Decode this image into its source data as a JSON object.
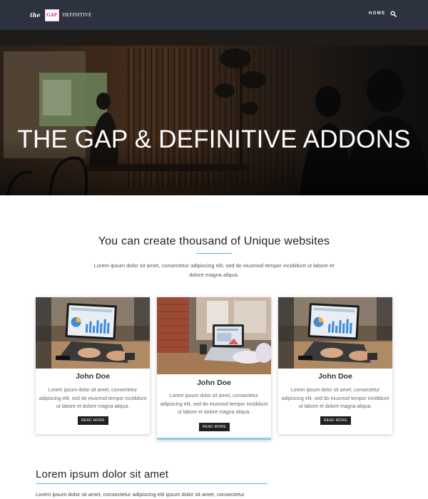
{
  "header": {
    "logo": {
      "the": "the",
      "gap": "GAP",
      "definitive": "DEFINITIVE"
    },
    "nav": {
      "home_label": "HOME"
    },
    "search_icon": "search-icon"
  },
  "hero": {
    "title": "THE GAP & DEFINITIVE ADDONS",
    "image": "cafe-interior-photo"
  },
  "intro": {
    "title": "You can create thousand of Unique websites",
    "text": "Lorem ipsum dolor sit amet, consectetur adipiscing elit, sed do eiusmod tempor incididunt ut labore et dolore magna aliqua."
  },
  "cards": [
    {
      "image": "laptop-charts-photo",
      "name": "John Doe",
      "text": "Lorem ipsum dolor sit amet, consectetur adipiscing elit, sed do eiusmod tempor incididunt ut labore et dolore magna aliqua.",
      "button": "READ MORE"
    },
    {
      "image": "laptop-office-photo",
      "name": "John Doe",
      "text": "Lorem ipsum dolor sit amet, consectetur adipiscing elit, sed do eiusmod tempor incididunt ut labore et dolore magna aliqua.",
      "button": "READ MORE"
    },
    {
      "image": "laptop-charts-photo",
      "name": "John Doe",
      "text": "Lorem ipsum dolor sit amet, consectetur adipiscing elit, sed do eiusmod tempor incididunt ut labore et dolore magna aliqua.",
      "button": "READ MORE"
    }
  ],
  "section": {
    "title": "Lorem ipsum dolor sit amet",
    "text": "Lorem ipsum dolor sit amet, consectetur adipiscing elit ipsum dolor sit amet, consectetur"
  },
  "colors": {
    "navbar": "#2d333e",
    "accent_line": "#5bb3e1",
    "button": "#1e2024",
    "logo_pink": "#e0237c"
  }
}
